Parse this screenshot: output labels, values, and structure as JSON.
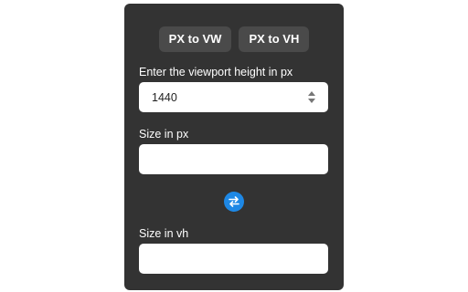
{
  "tabs": {
    "px_to_vw": "PX to VW",
    "px_to_vh": "PX to VH"
  },
  "viewport": {
    "label": "Enter the viewport height in px",
    "value": "1440"
  },
  "px_field": {
    "label": "Size in px",
    "value": ""
  },
  "swap": {
    "icon": "swap-arrows-icon",
    "color": "#1e88e5"
  },
  "vh_field": {
    "label": "Size in vh",
    "value": ""
  },
  "colors": {
    "panel": "#333333",
    "tab_bg": "#4a4a4a"
  }
}
